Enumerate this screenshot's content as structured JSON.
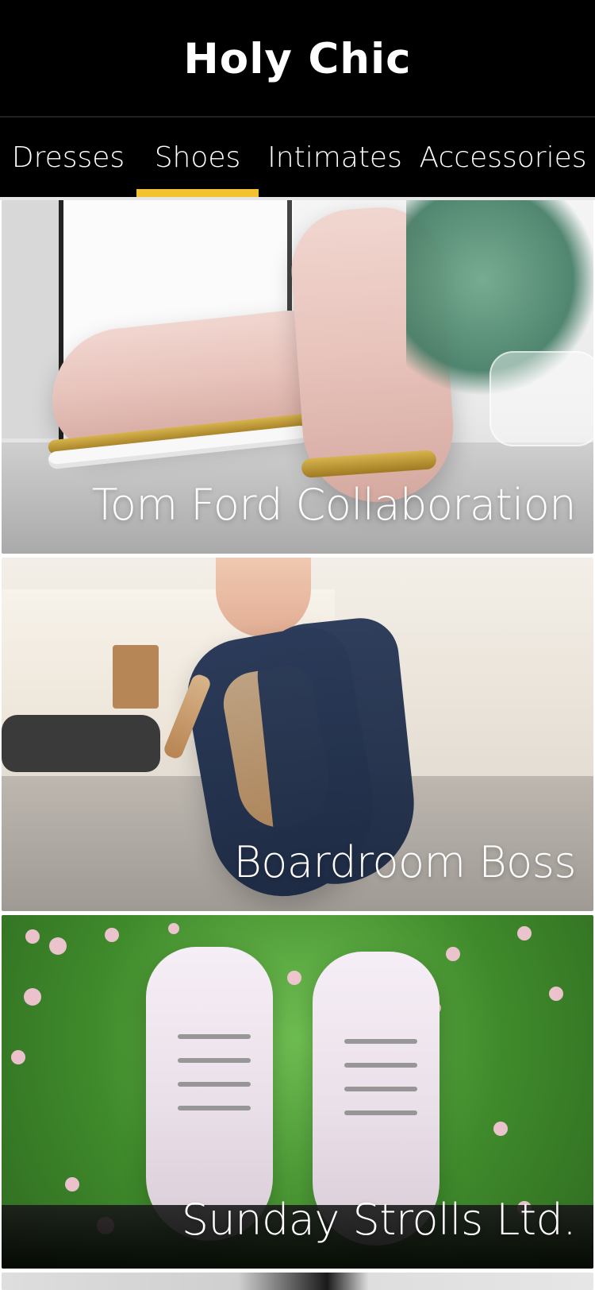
{
  "app": {
    "title": "Holy Chic"
  },
  "tabs": [
    {
      "label": "Dresses",
      "active": false
    },
    {
      "label": "Shoes",
      "active": true
    },
    {
      "label": "Intimates",
      "active": false
    },
    {
      "label": "Accessories",
      "active": false
    }
  ],
  "cards": [
    {
      "label": "Tom Ford Collaboration"
    },
    {
      "label": "Boardroom Boss"
    },
    {
      "label": "Sunday Strolls Ltd."
    },
    {
      "label": ""
    }
  ],
  "colors": {
    "header_bg": "#000000",
    "active_indicator": "#f2c230"
  },
  "icons": []
}
